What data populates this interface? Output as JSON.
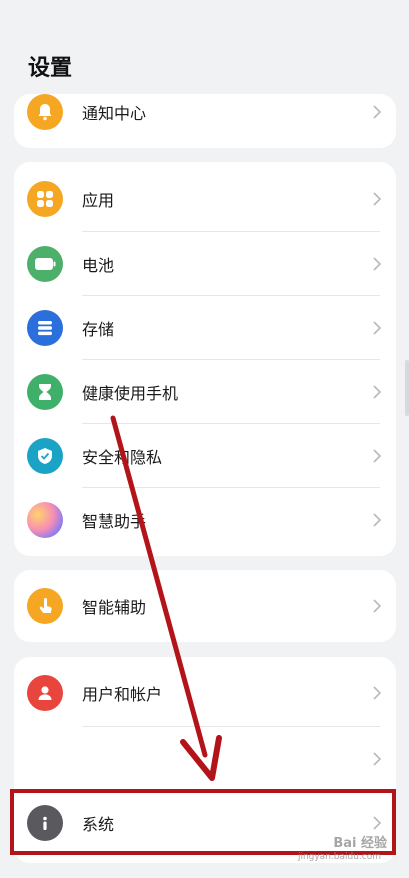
{
  "header": {
    "title": "设置"
  },
  "groups": {
    "g0": {
      "notification": {
        "label": "通知中心"
      }
    },
    "g1": {
      "apps": {
        "label": "应用"
      },
      "battery": {
        "label": "电池"
      },
      "storage": {
        "label": "存储"
      },
      "health": {
        "label": "健康使用手机"
      },
      "security": {
        "label": "安全和隐私"
      },
      "assistant": {
        "label": "智慧助手"
      }
    },
    "g2": {
      "accessibility": {
        "label": "智能辅助"
      }
    },
    "g3": {
      "users": {
        "label": "用户和帐户"
      },
      "hidden": {
        "label": ""
      },
      "system": {
        "label": "系统"
      }
    }
  },
  "watermark": {
    "brand": "Bai 经验",
    "sub": "jingyan.baidu.com"
  },
  "colors": {
    "notification": "#f5a623",
    "apps": "#f5a623",
    "battery": "#4caf6a",
    "storage": "#2a6fdb",
    "health": "#3fb06a",
    "security": "#1aa3c4",
    "accessibility": "#f5a623",
    "users": "#e8453c",
    "system": "#5a5a5e",
    "annotation": "#b3141a"
  }
}
